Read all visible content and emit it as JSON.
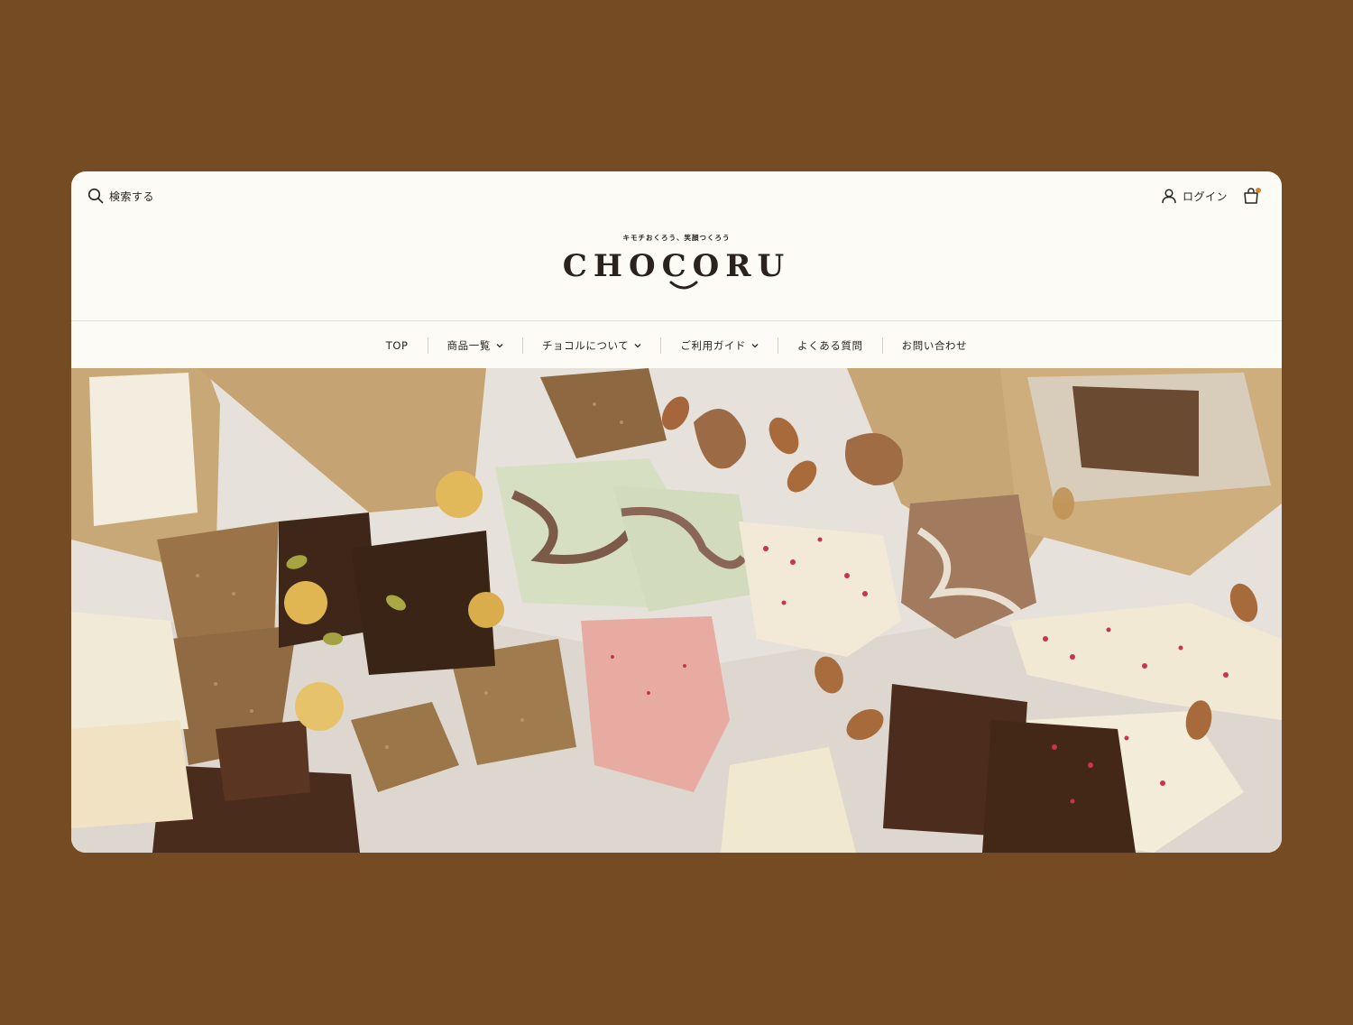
{
  "header": {
    "search_label": "検索する",
    "login_label": "ログイン",
    "tagline": "キモチおくろう、笑顔つくろう",
    "logo_text": "CHOCORU"
  },
  "nav": {
    "items": [
      {
        "label": "TOP",
        "has_dropdown": false
      },
      {
        "label": "商品一覧",
        "has_dropdown": true
      },
      {
        "label": "チョコルについて",
        "has_dropdown": true
      },
      {
        "label": "ご利用ガイド",
        "has_dropdown": true
      },
      {
        "label": "よくある質問",
        "has_dropdown": false
      },
      {
        "label": "お問い合わせ",
        "has_dropdown": false
      }
    ]
  },
  "colors": {
    "background": "#744b22",
    "page": "#fdfbf6",
    "text": "#2b2420",
    "cart_badge": "#c98a37"
  },
  "icons": [
    "search-icon",
    "user-icon",
    "cart-icon",
    "chevron-down-icon"
  ]
}
